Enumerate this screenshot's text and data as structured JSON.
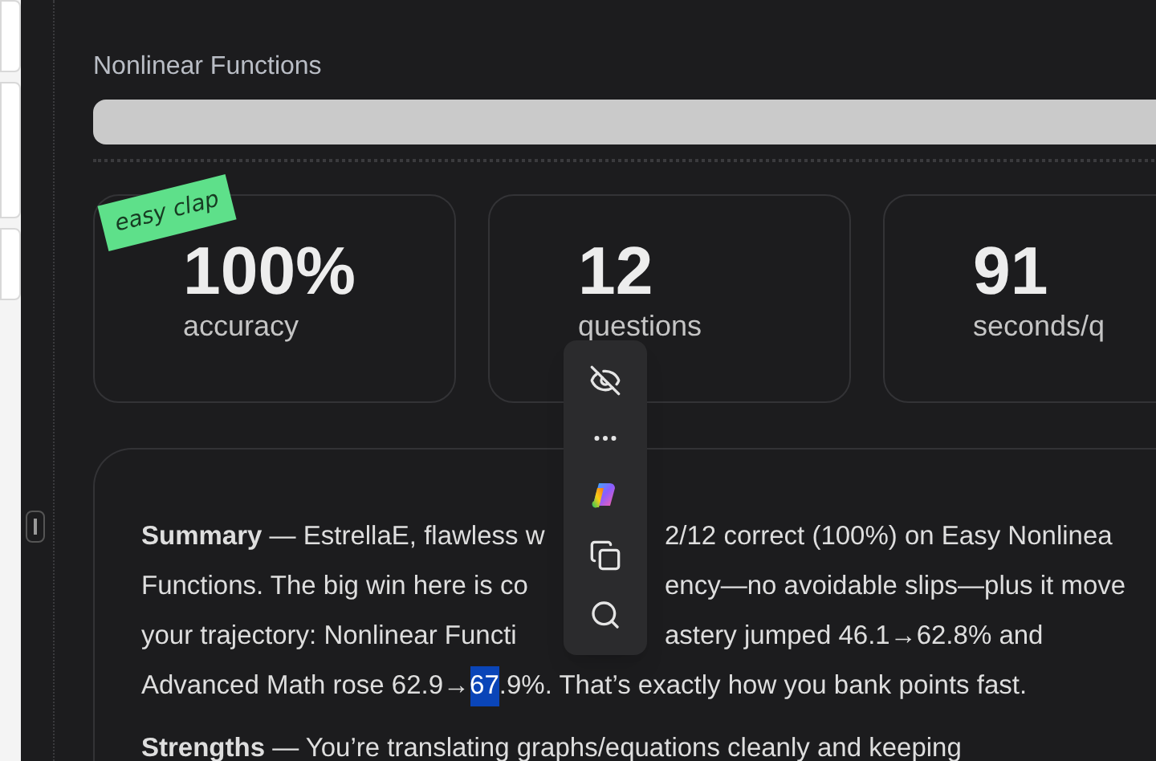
{
  "topic_title": "Nonlinear Functions",
  "sticker": "easy clap",
  "stats": [
    {
      "value": "100%",
      "label": "accuracy"
    },
    {
      "value": "12",
      "label": "questions"
    },
    {
      "value": "91",
      "label": "seconds/q"
    }
  ],
  "summary_lines": [
    {
      "kind": "split",
      "left": "**Summary** — EstrellaE, flawless w",
      "right": "2/12 correct (100%) on Easy Nonlinea"
    },
    {
      "kind": "split",
      "left": "Functions. The big win here is co",
      "right": "ency—no avoidable slips—plus it move"
    },
    {
      "kind": "split",
      "left": "your trajectory: Nonlinear Functi",
      "right": "astery jumped 46.1→62.8% and"
    },
    {
      "kind": "segments",
      "segments": [
        {
          "text": "Advanced Math rose 62.9→",
          "selected": false
        },
        {
          "text": "67",
          "selected": true
        },
        {
          "text": ".9%. That’s exactly how you bank points fast.",
          "selected": false
        }
      ]
    },
    {
      "kind": "segments",
      "segments": [
        {
          "text": "**Strengths** — You’re translating graphs/equations cleanly and keeping",
          "selected": false
        }
      ]
    }
  ]
}
